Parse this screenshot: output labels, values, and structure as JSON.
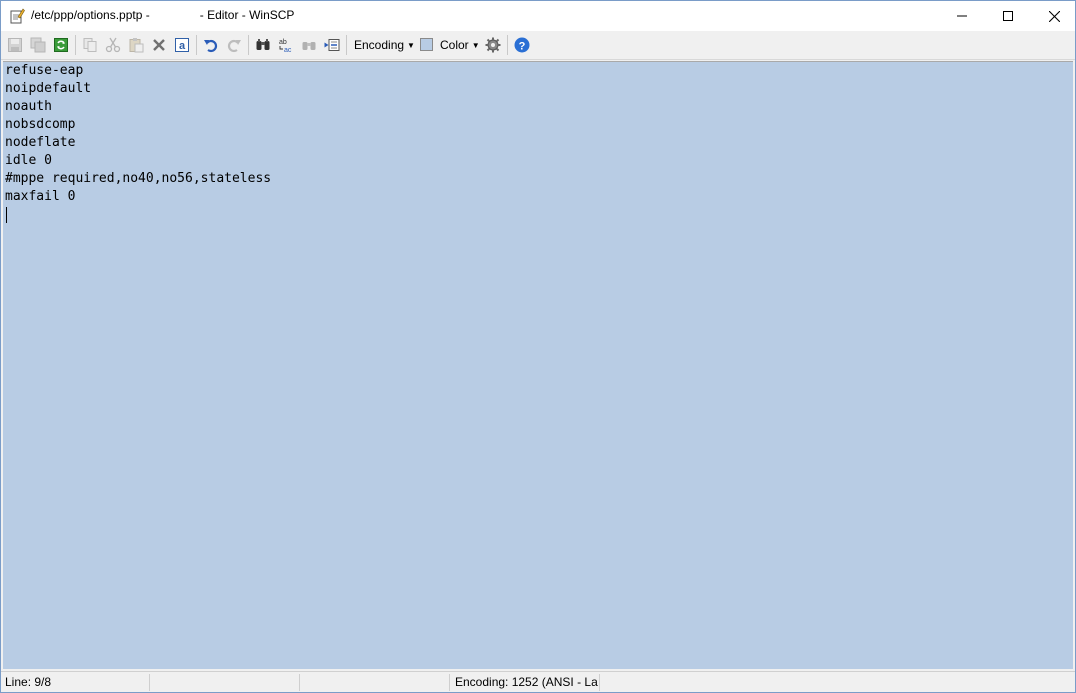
{
  "window": {
    "title": "/etc/ppp/options.pptp -               - Editor - WinSCP"
  },
  "toolbar": {
    "encoding_label": "Encoding",
    "color_label": "Color",
    "color_swatch": "#b8cce4"
  },
  "editor": {
    "lines": [
      "refuse-eap",
      "noipdefault",
      "noauth",
      "nobsdcomp",
      "nodeflate",
      "idle 0",
      "#mppe required,no40,no56,stateless",
      "maxfail 0"
    ],
    "background": "#b8cce4"
  },
  "statusbar": {
    "line_info": "Line: 9/8",
    "encoding_info": "Encoding: 1252  (ANSI - La"
  }
}
